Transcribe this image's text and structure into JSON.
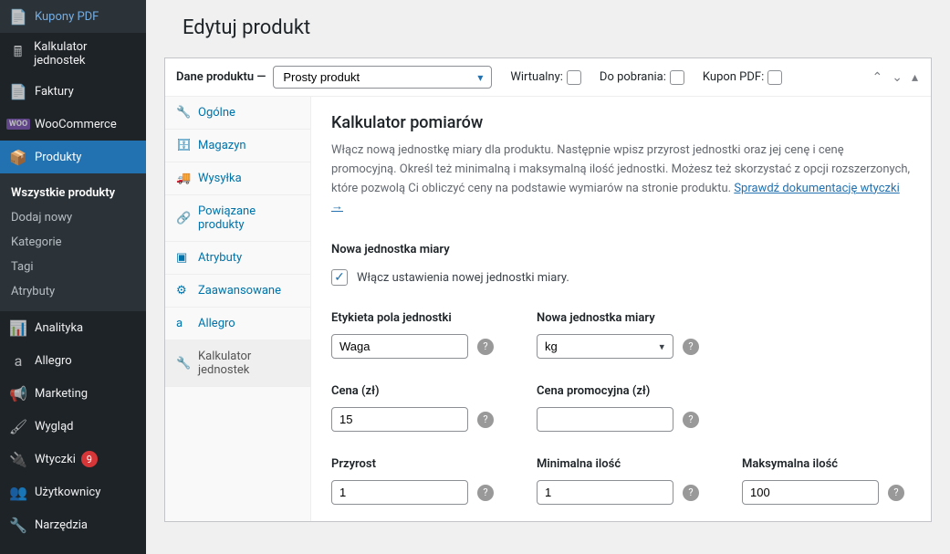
{
  "sidebar": [
    {
      "icon": "📄",
      "label": "Kupony PDF"
    },
    {
      "icon": "🖩",
      "label": "Kalkulator jednostek"
    },
    {
      "icon": "📄",
      "label": "Faktury"
    },
    {
      "icon": "WOO",
      "label": "WooCommerce",
      "woo": true
    },
    {
      "icon": "📦",
      "label": "Produkty",
      "active": true,
      "sub": [
        {
          "label": "Wszystkie produkty",
          "current": true
        },
        {
          "label": "Dodaj nowy"
        },
        {
          "label": "Kategorie"
        },
        {
          "label": "Tagi"
        },
        {
          "label": "Atrybuty"
        }
      ]
    },
    {
      "icon": "📊",
      "label": "Analityka"
    },
    {
      "icon": "a",
      "label": "Allegro"
    },
    {
      "icon": "📢",
      "label": "Marketing"
    },
    {
      "icon": "🖌",
      "label": "Wygląd"
    },
    {
      "icon": "🔌",
      "label": "Wtyczki",
      "badge": "9"
    },
    {
      "icon": "👥",
      "label": "Użytkownicy"
    },
    {
      "icon": "🔧",
      "label": "Narzędzia"
    }
  ],
  "page_title": "Edytuj produkt",
  "panel": {
    "label": "Dane produktu —",
    "type": "Prosty produkt",
    "checks": [
      {
        "label": "Wirtualny:"
      },
      {
        "label": "Do pobrania:"
      },
      {
        "label": "Kupon PDF:"
      }
    ]
  },
  "tabs": [
    {
      "icon": "🔧",
      "label": "Ogólne"
    },
    {
      "icon": "🗄",
      "label": "Magazyn"
    },
    {
      "icon": "🚚",
      "label": "Wysyłka"
    },
    {
      "icon": "🔗",
      "label": "Powiązane produkty"
    },
    {
      "icon": "▣",
      "label": "Atrybuty"
    },
    {
      "icon": "⚙",
      "label": "Zaawansowane"
    },
    {
      "icon": "a",
      "label": "Allegro"
    },
    {
      "icon": "🔧",
      "label": "Kalkulator jednostek",
      "active": true
    }
  ],
  "content": {
    "title": "Kalkulator pomiarów",
    "desc": "Włącz nową jednostkę miary dla produktu. Następnie wpisz przyrost jednostki oraz jej cenę i cenę promocyjną. Określ też minimalną i maksymalną ilość jednostki. Możesz też skorzystać z opcji rozszerzonych, które pozwolą Ci obliczyć ceny na podstawie wymiarów na stronie produktu. ",
    "doc_link": "Sprawdź dokumentację wtyczki →",
    "section_label": "Nowa jednostka miary",
    "enable_label": "Włącz ustawienia nowej jednostki miary.",
    "fields": {
      "label_field": {
        "label": "Etykieta pola jednostki",
        "value": "Waga"
      },
      "unit": {
        "label": "Nowa jednostka miary",
        "value": "kg"
      },
      "price": {
        "label": "Cena (zł)",
        "value": "15"
      },
      "sale_price": {
        "label": "Cena promocyjna (zł)",
        "value": ""
      },
      "step": {
        "label": "Przyrost",
        "value": "1"
      },
      "min": {
        "label": "Minimalna ilość",
        "value": "1"
      },
      "max": {
        "label": "Maksymalna ilość",
        "value": "100"
      }
    }
  }
}
